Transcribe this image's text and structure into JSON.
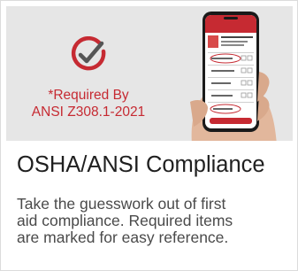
{
  "hero": {
    "required_line1": "*Required By",
    "required_line2": "ANSI Z308.1-2021",
    "badge_icon": "check-circle-icon",
    "accent_color": "#c62a32",
    "background_color": "#e6e6e6"
  },
  "title": "OSHA/ANSI Compliance",
  "description_lines": [
    "Take the guesswork out of first",
    "aid compliance. Required items",
    "are marked for easy reference."
  ]
}
